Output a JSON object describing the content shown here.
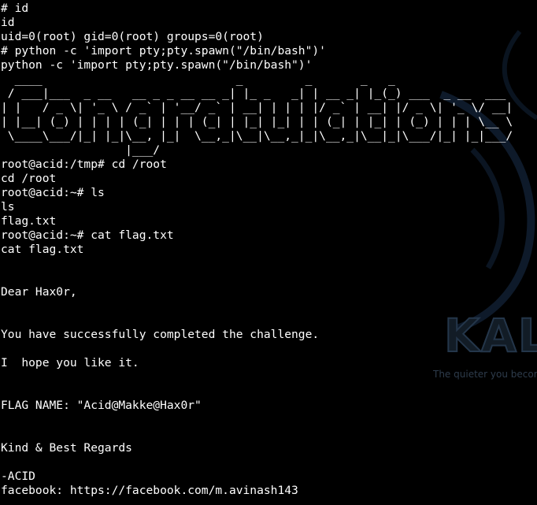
{
  "wallpaper": {
    "logo_text": "KALI",
    "tagline": "The quieter you become"
  },
  "terminal": {
    "lines": [
      "# id",
      "id",
      "uid=0(root) gid=0(root) groups=0(root)",
      "# python -c 'import pty;pty.spawn(\"/bin/bash\")'",
      "python -c 'import pty;pty.spawn(\"/bin/bash\")'"
    ],
    "banner": [
      "  ____                            _         _       _   _",
      " / ___|___  _ __   __ _ _ __ __ _| |_ _   _| | __ _| |_(_) ___  _ __  ___",
      "| |   / _ \\| '_ \\ / _` | '__/ _` | __| | | | |/ _` | __| |/ _ \\| '_ \\/ __|",
      "| |__| (_) | | | | (_| | | | (_| | |_| |_| | | (_| | |_| | (_) | | | \\__ \\",
      " \\____\\___/|_| |_|\\__, |_|  \\__,_|\\__|\\__,_|_|\\__,_|\\__|_|\\___/|_| |_|___/",
      "                  |___/"
    ],
    "session": [
      "root@acid:/tmp# cd /root",
      "cd /root",
      "root@acid:~# ls",
      "ls",
      "flag.txt",
      "root@acid:~# cat flag.txt",
      "cat flag.txt",
      "",
      "",
      "Dear Hax0r,",
      "",
      "",
      "You have successfully completed the challenge.",
      "",
      "I  hope you like it.",
      "",
      "",
      "FLAG NAME: \"Acid@Makke@Hax0r\"",
      "",
      "",
      "Kind & Best Regards",
      "",
      "-ACID",
      "facebook: https://facebook.com/m.avinash143"
    ]
  }
}
